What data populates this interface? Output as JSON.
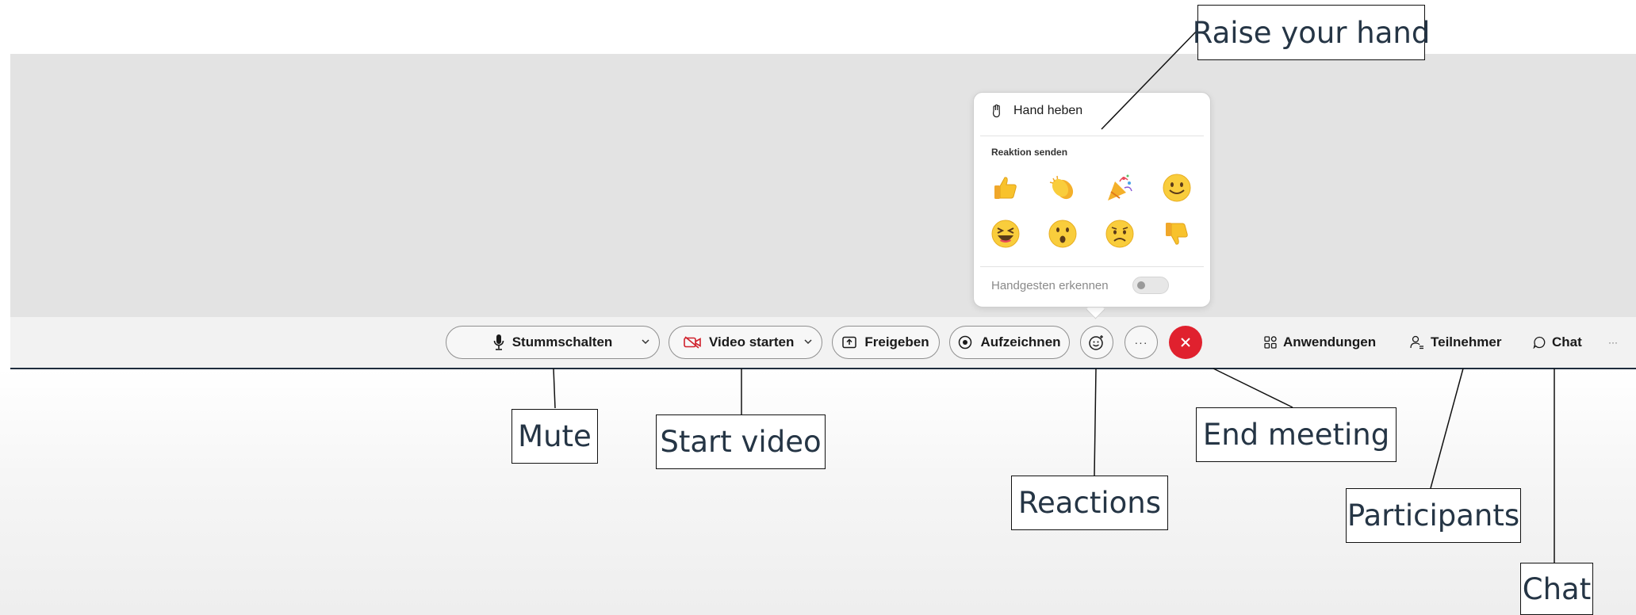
{
  "toolbar": {
    "mute_label": "Stummschalten",
    "video_label": "Video starten",
    "share_label": "Freigeben",
    "record_label": "Aufzeichnen",
    "more_label": "···",
    "apps_label": "Anwendungen",
    "participants_label": "Teilnehmer",
    "chat_label": "Chat",
    "overflow_label": "···"
  },
  "reactions_popup": {
    "raise_hand_label": "Hand heben",
    "section_title": "Reaktion senden",
    "emojis": [
      "thumbs-up",
      "clap",
      "party",
      "smile",
      "laugh",
      "surprised",
      "sad",
      "thumbs-down"
    ],
    "gesture_label": "Handgesten erkennen",
    "gesture_enabled": false
  },
  "callouts": {
    "raise_hand": "Raise your hand",
    "mute": "Mute",
    "start_video": "Start video",
    "reactions": "Reactions",
    "end_meeting": "End meeting",
    "participants": "Participants",
    "chat": "Chat"
  },
  "colors": {
    "end_button": "#e0212e",
    "video_off_icon": "#d0202b",
    "stage_bg": "#e3e3e3",
    "callout_text": "#253545"
  }
}
